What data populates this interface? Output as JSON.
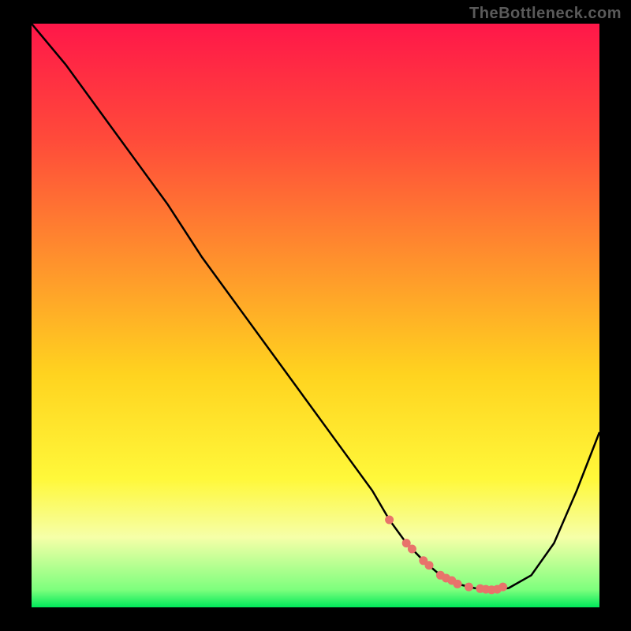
{
  "watermark": "TheBottleneck.com",
  "chart_data": {
    "type": "line",
    "title": "",
    "xlabel": "",
    "ylabel": "",
    "xlim": [
      0,
      100
    ],
    "ylim": [
      0,
      100
    ],
    "curve": {
      "name": "bottleneck-curve",
      "x": [
        0,
        6,
        12,
        18,
        24,
        30,
        36,
        42,
        48,
        54,
        60,
        63,
        66,
        69,
        72,
        75,
        78,
        81,
        84,
        88,
        92,
        96,
        100
      ],
      "y": [
        100,
        93,
        85,
        77,
        69,
        60,
        52,
        44,
        36,
        28,
        20,
        15,
        11,
        8,
        5.5,
        4,
        3.3,
        3,
        3.3,
        5.5,
        11,
        20,
        30
      ]
    },
    "markers": {
      "name": "highlight-points",
      "color": "#e8736b",
      "x": [
        63,
        66,
        67,
        69,
        70,
        72,
        73,
        74,
        75,
        77,
        79,
        80,
        81,
        82,
        83
      ],
      "y": [
        15,
        11,
        10,
        8,
        7.2,
        5.5,
        5,
        4.6,
        4,
        3.5,
        3.2,
        3.1,
        3,
        3.1,
        3.5
      ]
    },
    "gradient_stops": [
      {
        "offset": 0.0,
        "color": "#ff1749"
      },
      {
        "offset": 0.2,
        "color": "#ff4b3a"
      },
      {
        "offset": 0.4,
        "color": "#ff8f2d"
      },
      {
        "offset": 0.6,
        "color": "#ffd31f"
      },
      {
        "offset": 0.78,
        "color": "#fff83a"
      },
      {
        "offset": 0.88,
        "color": "#f6ffa8"
      },
      {
        "offset": 0.97,
        "color": "#7dff7d"
      },
      {
        "offset": 1.0,
        "color": "#00e85a"
      }
    ]
  }
}
